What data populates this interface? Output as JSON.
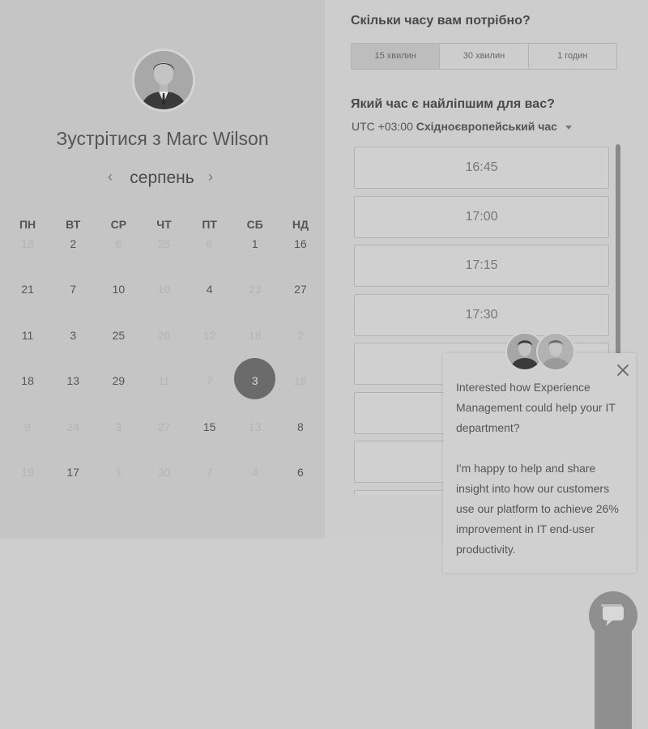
{
  "scheduler": {
    "title": "Зустрітися з Marc Wilson",
    "month": "серпень",
    "weekdays": [
      "ПН",
      "ВТ",
      "СР",
      "ЧТ",
      "ПТ",
      "СБ",
      "НД"
    ],
    "weeks": [
      [
        {
          "d": "18",
          "dim": true
        },
        {
          "d": "2",
          "dim": false
        },
        {
          "d": "6",
          "dim": true
        },
        {
          "d": "25",
          "dim": true
        },
        {
          "d": "6",
          "dim": true
        },
        {
          "d": "1",
          "dim": false
        },
        {
          "d": "16",
          "dim": false
        }
      ],
      [
        {
          "d": "21",
          "dim": false
        },
        {
          "d": "7",
          "dim": false
        },
        {
          "d": "10",
          "dim": false
        },
        {
          "d": "10",
          "dim": true
        },
        {
          "d": "4",
          "dim": false
        },
        {
          "d": "23",
          "dim": true
        },
        {
          "d": "27",
          "dim": false
        }
      ],
      [
        {
          "d": "11",
          "dim": false
        },
        {
          "d": "3",
          "dim": false
        },
        {
          "d": "25",
          "dim": false
        },
        {
          "d": "26",
          "dim": true
        },
        {
          "d": "12",
          "dim": true
        },
        {
          "d": "18",
          "dim": true
        },
        {
          "d": "2",
          "dim": true
        }
      ],
      [
        {
          "d": "18",
          "dim": false
        },
        {
          "d": "13",
          "dim": false
        },
        {
          "d": "29",
          "dim": false
        },
        {
          "d": "11",
          "dim": true
        },
        {
          "d": "7",
          "dim": true
        },
        {
          "d": "3",
          "dim": false,
          "selected": true
        },
        {
          "d": "18",
          "dim": true
        }
      ],
      [
        {
          "d": "9",
          "dim": true
        },
        {
          "d": "24",
          "dim": true
        },
        {
          "d": "3",
          "dim": true
        },
        {
          "d": "27",
          "dim": true
        },
        {
          "d": "15",
          "dim": false
        },
        {
          "d": "13",
          "dim": true
        },
        {
          "d": "8",
          "dim": false
        }
      ],
      [
        {
          "d": "19",
          "dim": true
        },
        {
          "d": "17",
          "dim": false
        },
        {
          "d": "1",
          "dim": true
        },
        {
          "d": "30",
          "dim": true
        },
        {
          "d": "7",
          "dim": true
        },
        {
          "d": "4",
          "dim": true
        },
        {
          "d": "6",
          "dim": false
        }
      ]
    ]
  },
  "booking": {
    "duration_question": "Скільки часу вам потрібно?",
    "durations": [
      "15 хвилин",
      "30 хвилин",
      "1 годин"
    ],
    "active_duration": 0,
    "time_question": "Який час є найліпшим для вас?",
    "timezone_prefix": "UTC +03:00",
    "timezone_name": "Східноєвропейський час",
    "slots": [
      "16:45",
      "17:00",
      "17:15",
      "17:30",
      "",
      "",
      "",
      ""
    ]
  },
  "chat_popup": {
    "message_1": "Interested how Experience Management could help your IT department?",
    "message_2": "I'm happy to help and share insight into how our customers use our platform to achieve 26% improvement in IT end-user productivity."
  },
  "icons": {
    "close": "close-icon",
    "chat": "chat-bubble-icon",
    "prev": "chevron-left-icon",
    "next": "chevron-right-icon"
  },
  "colors": {
    "overlay_bg": "#cecece",
    "selected_day": "#6b6b6b",
    "scrollbar": "#8a8a8a",
    "launcher": "#8f8f8f"
  }
}
